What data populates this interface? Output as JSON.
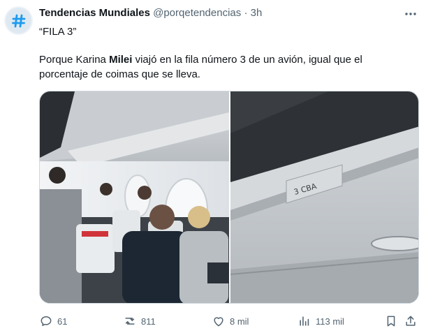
{
  "tweet": {
    "author_name": "Tendencias Mundiales",
    "handle": "@porqetendencias",
    "separator": "·",
    "time": "3h",
    "line1": "“FILA 3”",
    "line2_pre": "Porque Karina ",
    "line2_bold": "Milei",
    "line2_post": " viajó en la fila número 3 de un avión, igual que el",
    "line3": "porcentaje de coimas que se lleva.",
    "photo2_label": "3 CBA"
  },
  "actions": {
    "replies": "61",
    "retweets": "811",
    "likes": "8 mil",
    "views": "113 mil"
  },
  "colors": {
    "text": "#0f1419",
    "secondary": "#536471",
    "avatar_accent": "#1d9bf0",
    "border": "#cfd9de"
  }
}
